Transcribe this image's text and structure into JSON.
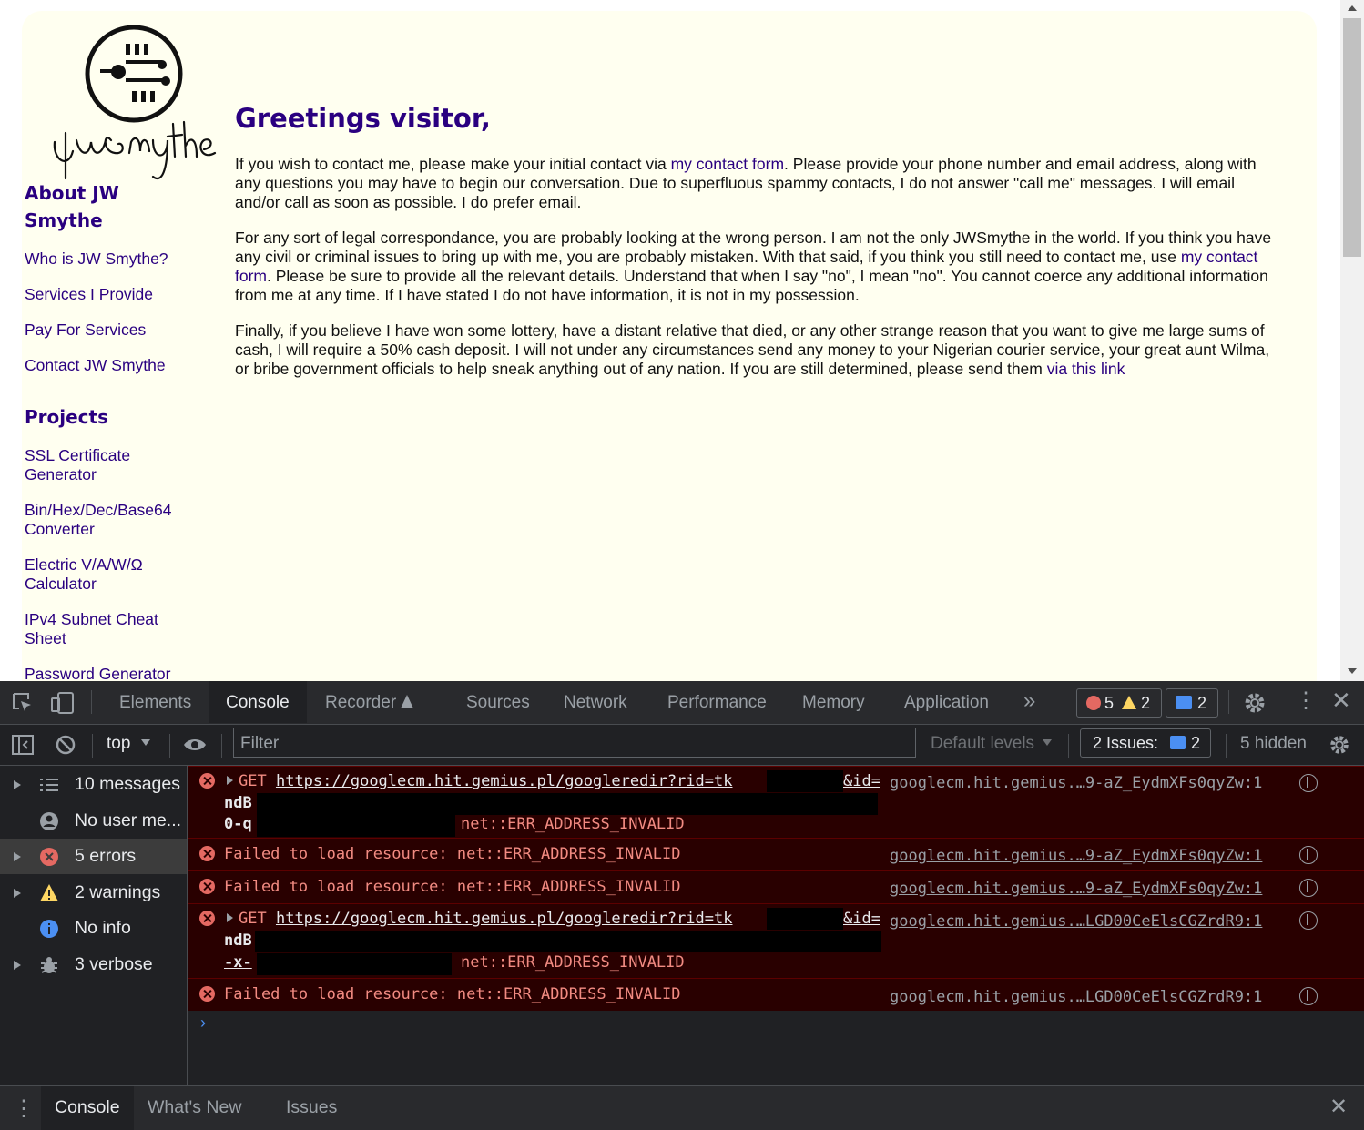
{
  "page": {
    "logo_text": "JWSmythe",
    "sidebar": {
      "about_heading": "About JW Smythe",
      "about_links": [
        "Who is JW Smythe?",
        "Services I Provide",
        "Pay For Services",
        "Contact JW Smythe"
      ],
      "projects_heading": "Projects",
      "project_links": [
        "SSL Certificate Generator",
        "Bin/Hex/Dec/Base64 Converter",
        "Electric V/A/W/Ω Calculator",
        "IPv4 Subnet Cheat Sheet",
        "Password Generator"
      ]
    },
    "heading": "Greetings visitor,",
    "p1": {
      "a": "If you wish to contact me, please make your initial contact via ",
      "link": "my contact form",
      "b": ". Please provide your phone number and email address, along with any questions you may have to begin our conversation. Due to superfluous spammy contacts, I do not answer \"call me\" messages. I will email and/or call as soon as possible. I do prefer email."
    },
    "p2": {
      "a": "For any sort of legal correspondance, you are probably looking at the wrong person. I am not the only JWSmythe in the world. If you think you have any civil or criminal issues to bring up with me, you are probably mistaken. With that said, if you think you still need to contact me, use ",
      "link": "my contact form",
      "b": ". Please be sure to provide all the relevant details. Understand that when I say \"no\", I mean \"no\". You cannot coerce any additional information from me at any time. If I have stated I do not have information, it is not in my possession."
    },
    "p3": {
      "a": "Finally, if you believe I have won some lottery, have a distant relative that died, or any other strange reason that you want to give me large sums of cash, I will require a 50% cash deposit. I will not under any circumstances send any money to your Nigerian courier service, your great aunt Wilma, or bribe government officials to help sneak anything out of any nation. If you are still determined, please send them ",
      "link": "via this link"
    }
  },
  "devtools": {
    "tabs": [
      "Elements",
      "Console",
      "Recorder",
      "Sources",
      "Network",
      "Performance",
      "Memory",
      "Application"
    ],
    "active_tab": "Console",
    "error_count": "5",
    "warning_count": "2",
    "message_count": "2",
    "toolbar": {
      "context": "top",
      "filter_placeholder": "Filter",
      "levels": "Default levels",
      "issues_label": "2 Issues:",
      "issues_count": "2",
      "hidden": "5 hidden"
    },
    "sidebar": [
      {
        "label": "10 messages",
        "icon": "list-icon"
      },
      {
        "label": "No user me...",
        "icon": "user-icon"
      },
      {
        "label": "5 errors",
        "icon": "error-icon"
      },
      {
        "label": "2 warnings",
        "icon": "warning-icon"
      },
      {
        "label": "No info",
        "icon": "info-icon"
      },
      {
        "label": "3 verbose",
        "icon": "bug-icon"
      }
    ],
    "messages": [
      {
        "method": "GET",
        "url": "https://googlecm.hit.gemius.pl/googleredir?rid=tk",
        "id_param": "&id=",
        "line2": "ndB",
        "line3": "0-q",
        "error": "net::ERR_ADDRESS_INVALID",
        "source": "googlecm.hit.gemius.…9-aZ_EydmXFs0qyZw:1"
      },
      {
        "text": "Failed to load resource: net::ERR_ADDRESS_INVALID",
        "source": "googlecm.hit.gemius.…9-aZ_EydmXFs0qyZw:1"
      },
      {
        "text": "Failed to load resource: net::ERR_ADDRESS_INVALID",
        "source": "googlecm.hit.gemius.…9-aZ_EydmXFs0qyZw:1"
      },
      {
        "method": "GET",
        "url": "https://googlecm.hit.gemius.pl/googleredir?rid=tk",
        "id_param": "&id=",
        "line2": "ndB",
        "line3": "-x-",
        "error": "net::ERR_ADDRESS_INVALID",
        "source": "googlecm.hit.gemius.…LGD00CeElsCGZrdR9:1"
      },
      {
        "text": "Failed to load resource: net::ERR_ADDRESS_INVALID",
        "source": "googlecm.hit.gemius.…LGD00CeElsCGZrdR9:1"
      }
    ],
    "drawer_tabs": [
      "Console",
      "What's New",
      "Issues"
    ]
  }
}
